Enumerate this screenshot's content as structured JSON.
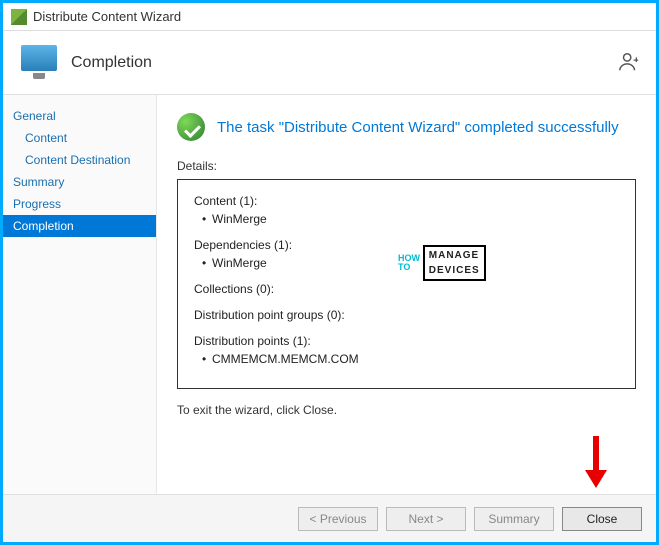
{
  "window": {
    "title": "Distribute Content Wizard"
  },
  "header": {
    "title": "Completion"
  },
  "sidebar": {
    "items": [
      {
        "label": "General",
        "indent": false
      },
      {
        "label": "Content",
        "indent": true
      },
      {
        "label": "Content Destination",
        "indent": true
      },
      {
        "label": "Summary",
        "indent": false
      },
      {
        "label": "Progress",
        "indent": false
      },
      {
        "label": "Completion",
        "indent": false
      }
    ],
    "selected": "Completion"
  },
  "main": {
    "success_message": "The task \"Distribute Content Wizard\" completed successfully",
    "details_label": "Details:",
    "details": {
      "content_header": "Content (1):",
      "content_item": "WinMerge",
      "dependencies_header": "Dependencies (1):",
      "dependencies_item": "WinMerge",
      "collections_header": "Collections (0):",
      "dpg_header": "Distribution point groups (0):",
      "dp_header": "Distribution points (1):",
      "dp_item": "CMMEMCM.MEMCM.COM"
    },
    "exit_text": "To exit the wizard, click Close."
  },
  "footer": {
    "previous": "< Previous",
    "next": "Next >",
    "summary": "Summary",
    "close": "Close"
  },
  "watermark": {
    "how": "HOW",
    "to": "TO",
    "manage": "MANAGE",
    "devices": "DEVICES"
  }
}
